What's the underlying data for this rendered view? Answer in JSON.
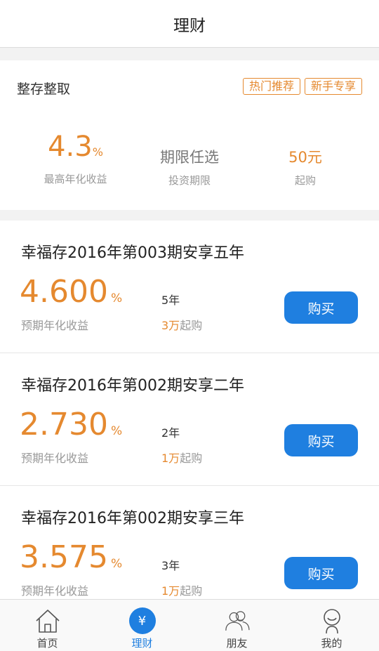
{
  "nav": {
    "title": "理财"
  },
  "featured": {
    "name": "整存整取",
    "tags": [
      "热门推荐",
      "新手专享"
    ],
    "rate_value": "4.3",
    "rate_unit": "%",
    "rate_label": "最高年化收益",
    "term_value": "期限任选",
    "term_label": "投资期限",
    "min_value": "50元",
    "min_label": "起购"
  },
  "products": [
    {
      "title": "幸福存2016年第003期安享五年",
      "rate": "4.600",
      "rate_unit": "%",
      "rate_label": "预期年化收益",
      "term": "5年",
      "min_amount": "3万",
      "min_suffix": "起购",
      "button": "购买"
    },
    {
      "title": "幸福存2016年第002期安享二年",
      "rate": "2.730",
      "rate_unit": "%",
      "rate_label": "预期年化收益",
      "term": "2年",
      "min_amount": "1万",
      "min_suffix": "起购",
      "button": "购买"
    },
    {
      "title": "幸福存2016年第002期安享三年",
      "rate": "3.575",
      "rate_unit": "%",
      "rate_label": "预期年化收益",
      "term": "3年",
      "min_amount": "1万",
      "min_suffix": "起购",
      "button": "购买"
    }
  ],
  "tabbar": {
    "items": [
      {
        "label": "首页",
        "icon": "home-icon"
      },
      {
        "label": "理财",
        "icon": "yen-icon",
        "glyph": "¥",
        "active": true
      },
      {
        "label": "朋友",
        "icon": "friends-icon"
      },
      {
        "label": "我的",
        "icon": "profile-icon"
      }
    ]
  },
  "colors": {
    "accent_orange": "#e5892f",
    "primary_blue": "#1f7fe0"
  }
}
